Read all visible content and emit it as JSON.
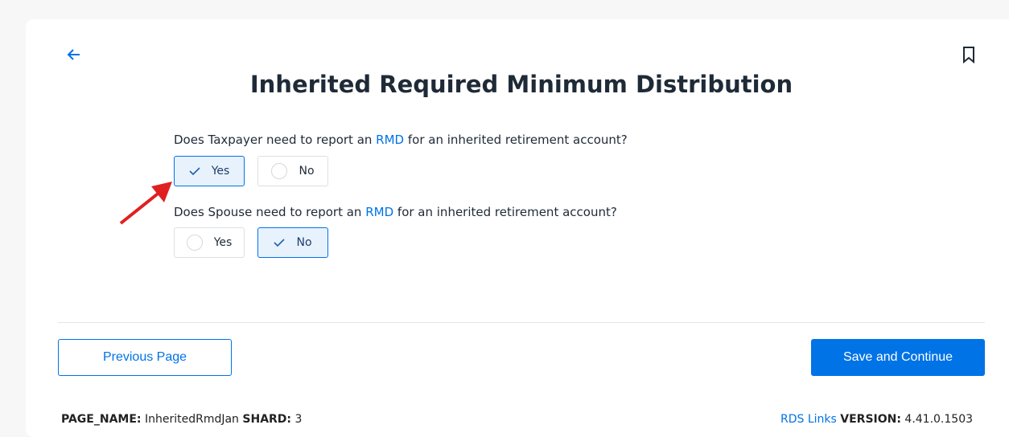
{
  "title": "Inherited Required Minimum Distribution",
  "questions": [
    {
      "pre": "Does Taxpayer need to report an ",
      "link": "RMD",
      "post": " for an inherited retirement account?",
      "yes": "Yes",
      "no": "No",
      "selected": "Yes"
    },
    {
      "pre": "Does Spouse need to report an ",
      "link": "RMD",
      "post": " for an inherited retirement account?",
      "yes": "Yes",
      "no": "No",
      "selected": "No"
    }
  ],
  "buttons": {
    "previous": "Previous Page",
    "save": "Save and Continue"
  },
  "footer": {
    "page_name_label": "PAGE_NAME:",
    "page_name": "InheritedRmdJan",
    "shard_label": "SHARD:",
    "shard": "3",
    "links": "RDS Links",
    "version_label": "VERSION:",
    "version": "4.41.0.1503"
  },
  "colors": {
    "accent": "#0073e6",
    "arrow": "#e02020"
  }
}
